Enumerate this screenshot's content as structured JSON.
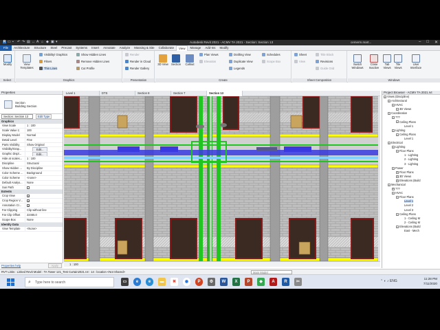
{
  "app": {
    "title": "Autodesk Revit 2021 - ACMV TA 2021 - Section: Section 13",
    "user": "cemerm.mart...",
    "window_controls": [
      "–",
      "□",
      "✕"
    ]
  },
  "ribbon_tabs": [
    "File",
    "Architecture",
    "Structure",
    "Steel",
    "Precast",
    "Systems",
    "Insert",
    "Annotate",
    "Analyze",
    "Massing & Site",
    "Collaborate",
    "View",
    "Manage",
    "Add-Ins",
    "Modify"
  ],
  "active_ribbon_tab": "View",
  "ribbon": {
    "select": {
      "modify": "Modify",
      "label": "Select"
    },
    "graphics": {
      "view_templates": "View Templates",
      "visibility": "Visibility/ Graphics",
      "filters": "Filters",
      "thin_lines": "Thin Lines",
      "show_hidden": "Show  Hidden Lines",
      "remove_hidden": "Remove  Hidden Lines",
      "cut_profile": "Cut  Profile",
      "label": "Graphics"
    },
    "presentation": {
      "render": "Render",
      "render_cloud": "Render  in Cloud",
      "render_gallery": "Render  Gallery",
      "label": "Presentation"
    },
    "create": {
      "view3d": "3D View",
      "section": "Section",
      "callout": "Callout",
      "plan_views": "Plan  Views",
      "elevation": "Elevation",
      "drafting": "Drafting  View",
      "duplicate": "Duplicate  View",
      "legends": "Legends",
      "schedules": "Schedules",
      "scope_box": "Scope  Box",
      "label": "Create"
    },
    "sheet": {
      "sheet": "Sheet",
      "view": "View",
      "title_block": "Title  Block",
      "revisions": "Revisions",
      "guide_grid": "Guide  Grid",
      "label": "Sheet Composition"
    },
    "windows": {
      "switch": "Switch Windows",
      "close_inactive": "Close Inactive",
      "tab_views": "Tab Views",
      "tile_views": "Tile Views",
      "user_interface": "User Interface",
      "label": "Windows"
    }
  },
  "properties": {
    "header": "Properties",
    "type_name_line1": "Section",
    "type_name_line2": "Building Section",
    "instance_selector": "Section: Section 13",
    "edit_type": "Edit Type",
    "categories": {
      "graphics": "Graphics",
      "extents": "Extents",
      "identity": "Identity Data"
    },
    "graphics_rows": [
      {
        "name": "View Scale",
        "value": "1 : 100"
      },
      {
        "name": "Scale Value 1:",
        "value": "100"
      },
      {
        "name": "Display Model",
        "value": "Normal"
      },
      {
        "name": "Detail Level",
        "value": "Fine"
      },
      {
        "name": "Parts Visibility",
        "value": "Show Original"
      },
      {
        "name": "Visibility/Grap...",
        "value": "Edit..."
      },
      {
        "name": "Graphic Displ...",
        "value": "Edit..."
      },
      {
        "name": "Hide at scales...",
        "value": "1 : 100"
      },
      {
        "name": "Discipline",
        "value": "Structural"
      },
      {
        "name": "Show Hidden ...",
        "value": "By Discipline"
      },
      {
        "name": "Color Scheme ...",
        "value": "Background"
      },
      {
        "name": "Color Scheme",
        "value": "<none>"
      },
      {
        "name": "Default Analys...",
        "value": "None"
      },
      {
        "name": "Sun Path",
        "value": ""
      }
    ],
    "extents_rows": [
      {
        "name": "Crop View",
        "value": ""
      },
      {
        "name": "Crop Region V...",
        "value": ""
      },
      {
        "name": "Annotation Cr...",
        "value": ""
      },
      {
        "name": "Far Clipping",
        "value": "Clip without line"
      },
      {
        "name": "Far Clip Offset",
        "value": "22465.0"
      },
      {
        "name": "Scope Box",
        "value": "None"
      }
    ],
    "identity_rows": [
      {
        "name": "View Template",
        "value": "<None>"
      }
    ],
    "help_link": "Properties help",
    "apply": "Apply"
  },
  "view_tabs": [
    "Level 1",
    "DTS",
    "Section 8",
    "Section 7",
    "Section 13"
  ],
  "active_view_tab": "Section 13",
  "view_bar": {
    "scale": "1 : 100"
  },
  "project_browser": {
    "header": "Project Browser - ACMV TA 2021.rvt",
    "nodes": [
      {
        "depth": 0,
        "toggle": "–",
        "label": "Views (Discipline)"
      },
      {
        "depth": 1,
        "toggle": "–",
        "label": "Architectural"
      },
      {
        "depth": 2,
        "toggle": "–",
        "label": "HVAC"
      },
      {
        "depth": 3,
        "toggle": "–",
        "label": "3D Views"
      },
      {
        "depth": 1,
        "toggle": "–",
        "label": "Coordination"
      },
      {
        "depth": 2,
        "toggle": "–",
        "label": "???"
      },
      {
        "depth": 3,
        "toggle": "–",
        "label": "Ceiling Plans"
      },
      {
        "depth": 4,
        "toggle": "",
        "label": "Level 1"
      },
      {
        "depth": 2,
        "toggle": "–",
        "label": "Lighting"
      },
      {
        "depth": 3,
        "toggle": "–",
        "label": "Ceiling Plans"
      },
      {
        "depth": 4,
        "toggle": "",
        "label": "Level 1"
      },
      {
        "depth": 1,
        "toggle": "–",
        "label": "Electrical"
      },
      {
        "depth": 2,
        "toggle": "–",
        "label": "Lighting"
      },
      {
        "depth": 3,
        "toggle": "–",
        "label": "Floor Plans"
      },
      {
        "depth": 4,
        "toggle": "",
        "label": "1 - Lighting"
      },
      {
        "depth": 4,
        "toggle": "",
        "label": "2 - Lighting"
      },
      {
        "depth": 4,
        "toggle": "",
        "label": "3 - Lighting"
      },
      {
        "depth": 2,
        "toggle": "–",
        "label": "Power"
      },
      {
        "depth": 3,
        "toggle": "+",
        "label": "Floor Plans"
      },
      {
        "depth": 3,
        "toggle": "+",
        "label": "3D Views"
      },
      {
        "depth": 3,
        "toggle": "+",
        "label": "Elevations (Build"
      },
      {
        "depth": 1,
        "toggle": "–",
        "label": "Mechanical"
      },
      {
        "depth": 2,
        "toggle": "+",
        "label": "???"
      },
      {
        "depth": 2,
        "toggle": "–",
        "label": "HVAC"
      },
      {
        "depth": 3,
        "toggle": "–",
        "label": "Floor Plans"
      },
      {
        "depth": 4,
        "toggle": "",
        "label": "Level 1"
      },
      {
        "depth": 4,
        "toggle": "",
        "label": "Level 2"
      },
      {
        "depth": 4,
        "toggle": "",
        "label": "Level 3"
      },
      {
        "depth": 3,
        "toggle": "–",
        "label": "Ceiling Plans"
      },
      {
        "depth": 4,
        "toggle": "",
        "label": "1 - Ceiling M"
      },
      {
        "depth": 4,
        "toggle": "",
        "label": "2 - Ceiling M"
      },
      {
        "depth": 3,
        "toggle": "–",
        "label": "Elevations (Build"
      },
      {
        "depth": 4,
        "toggle": "",
        "label": "East - Mech"
      }
    ],
    "selected_label": "Level 1 (HVAC Floor Plans)"
  },
  "status_bar": {
    "text": "RVT Links : Linked Revit Model : TA Tower 121_Test Curtain2021.rvt : 14 : location <Not Shared>",
    "model": "Main Model"
  },
  "taskbar": {
    "search_placeholder": "Type here to search",
    "time": "11:28 PM",
    "date": "7/11/2020",
    "lang": "ENG"
  },
  "colors": {
    "file_tab": "#1f5dab",
    "wall": "#bdbdbd",
    "slab_yellow": "#ffff00",
    "duct_blue": "#3a3ae0",
    "pipe_green": "#21c521",
    "window_frame": "#8b1a1a"
  }
}
